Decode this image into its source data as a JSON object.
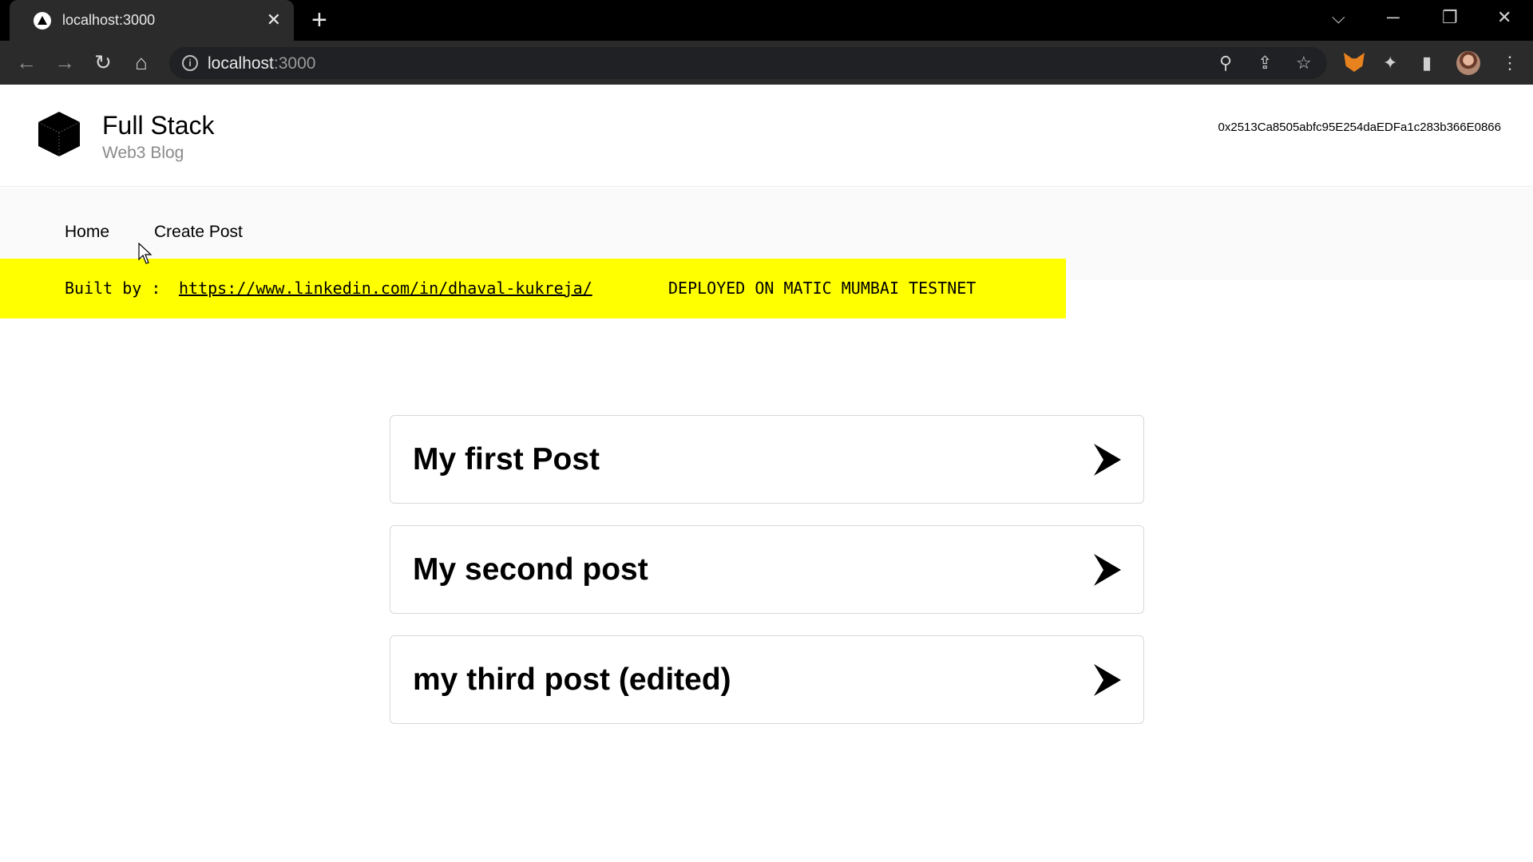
{
  "browser": {
    "tab": {
      "title": "localhost:3000",
      "close": "✕"
    },
    "new_tab": "+",
    "window_controls": {
      "dropdown": "⌵",
      "minimize": "─",
      "restore": "❐",
      "close": "✕"
    },
    "nav": {
      "back": "←",
      "forward": "→",
      "reload": "↻",
      "home": "⌂"
    },
    "address": {
      "host": "localhost",
      "port": ":3000",
      "info": "i"
    },
    "toolbar_icons": {
      "zoom": "⚲",
      "share": "⇪",
      "bookmark": "☆",
      "extensions": "✦",
      "sidepanel": "▮",
      "menu": "⋮"
    }
  },
  "site": {
    "title": "Full Stack",
    "subtitle": "Web3 Blog",
    "wallet_address": "0x2513Ca8505abfc95E254daEDFa1c283b366E0866"
  },
  "nav": {
    "home": "Home",
    "create_post": "Create Post"
  },
  "banner": {
    "prefix": "Built by :",
    "link": "https://www.linkedin.com/in/dhaval-kukreja/",
    "deployed": "DEPLOYED ON MATIC MUMBAI TESTNET",
    "color": "#ffff00"
  },
  "posts": [
    {
      "title": "My first Post"
    },
    {
      "title": "My second post"
    },
    {
      "title": "my third post (edited)"
    }
  ]
}
